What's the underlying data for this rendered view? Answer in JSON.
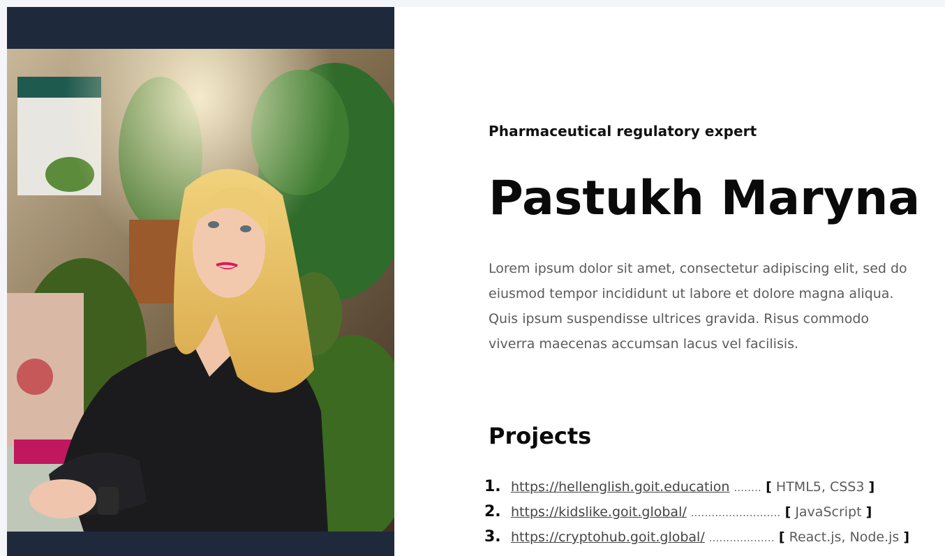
{
  "profile": {
    "subtitle": "Pharmaceutical regulatory expert",
    "name": "Pastukh Maryna",
    "bio": "Lorem ipsum dolor sit amet, consectetur adipiscing elit, sed do eiusmod tempor incididunt ut labore et dolore magna aliqua. Quis ipsum suspendisse ultrices gravida. Risus commodo viverra maecenas accumsan lacus vel facilisis."
  },
  "projects": {
    "title": "Projects",
    "items": [
      {
        "num": "1.",
        "url": "https://hellenglish.goit.education",
        "dots": "........",
        "tech": "HTML5, CSS3"
      },
      {
        "num": "2.",
        "url": "https://kidslike.goit.global/",
        "dots": "..........................",
        "tech": "JavaScript"
      },
      {
        "num": "3.",
        "url": "https://cryptohub.goit.global/",
        "dots": "...................",
        "tech": "React.js, Node.js"
      }
    ]
  },
  "colors": {
    "photo_frame": "#1e293b",
    "page_bg": "#f4f5f9",
    "text_primary": "#0a0a0a",
    "text_secondary": "#5b5b5b"
  },
  "icons": {
    "photo": "profile-photo"
  }
}
